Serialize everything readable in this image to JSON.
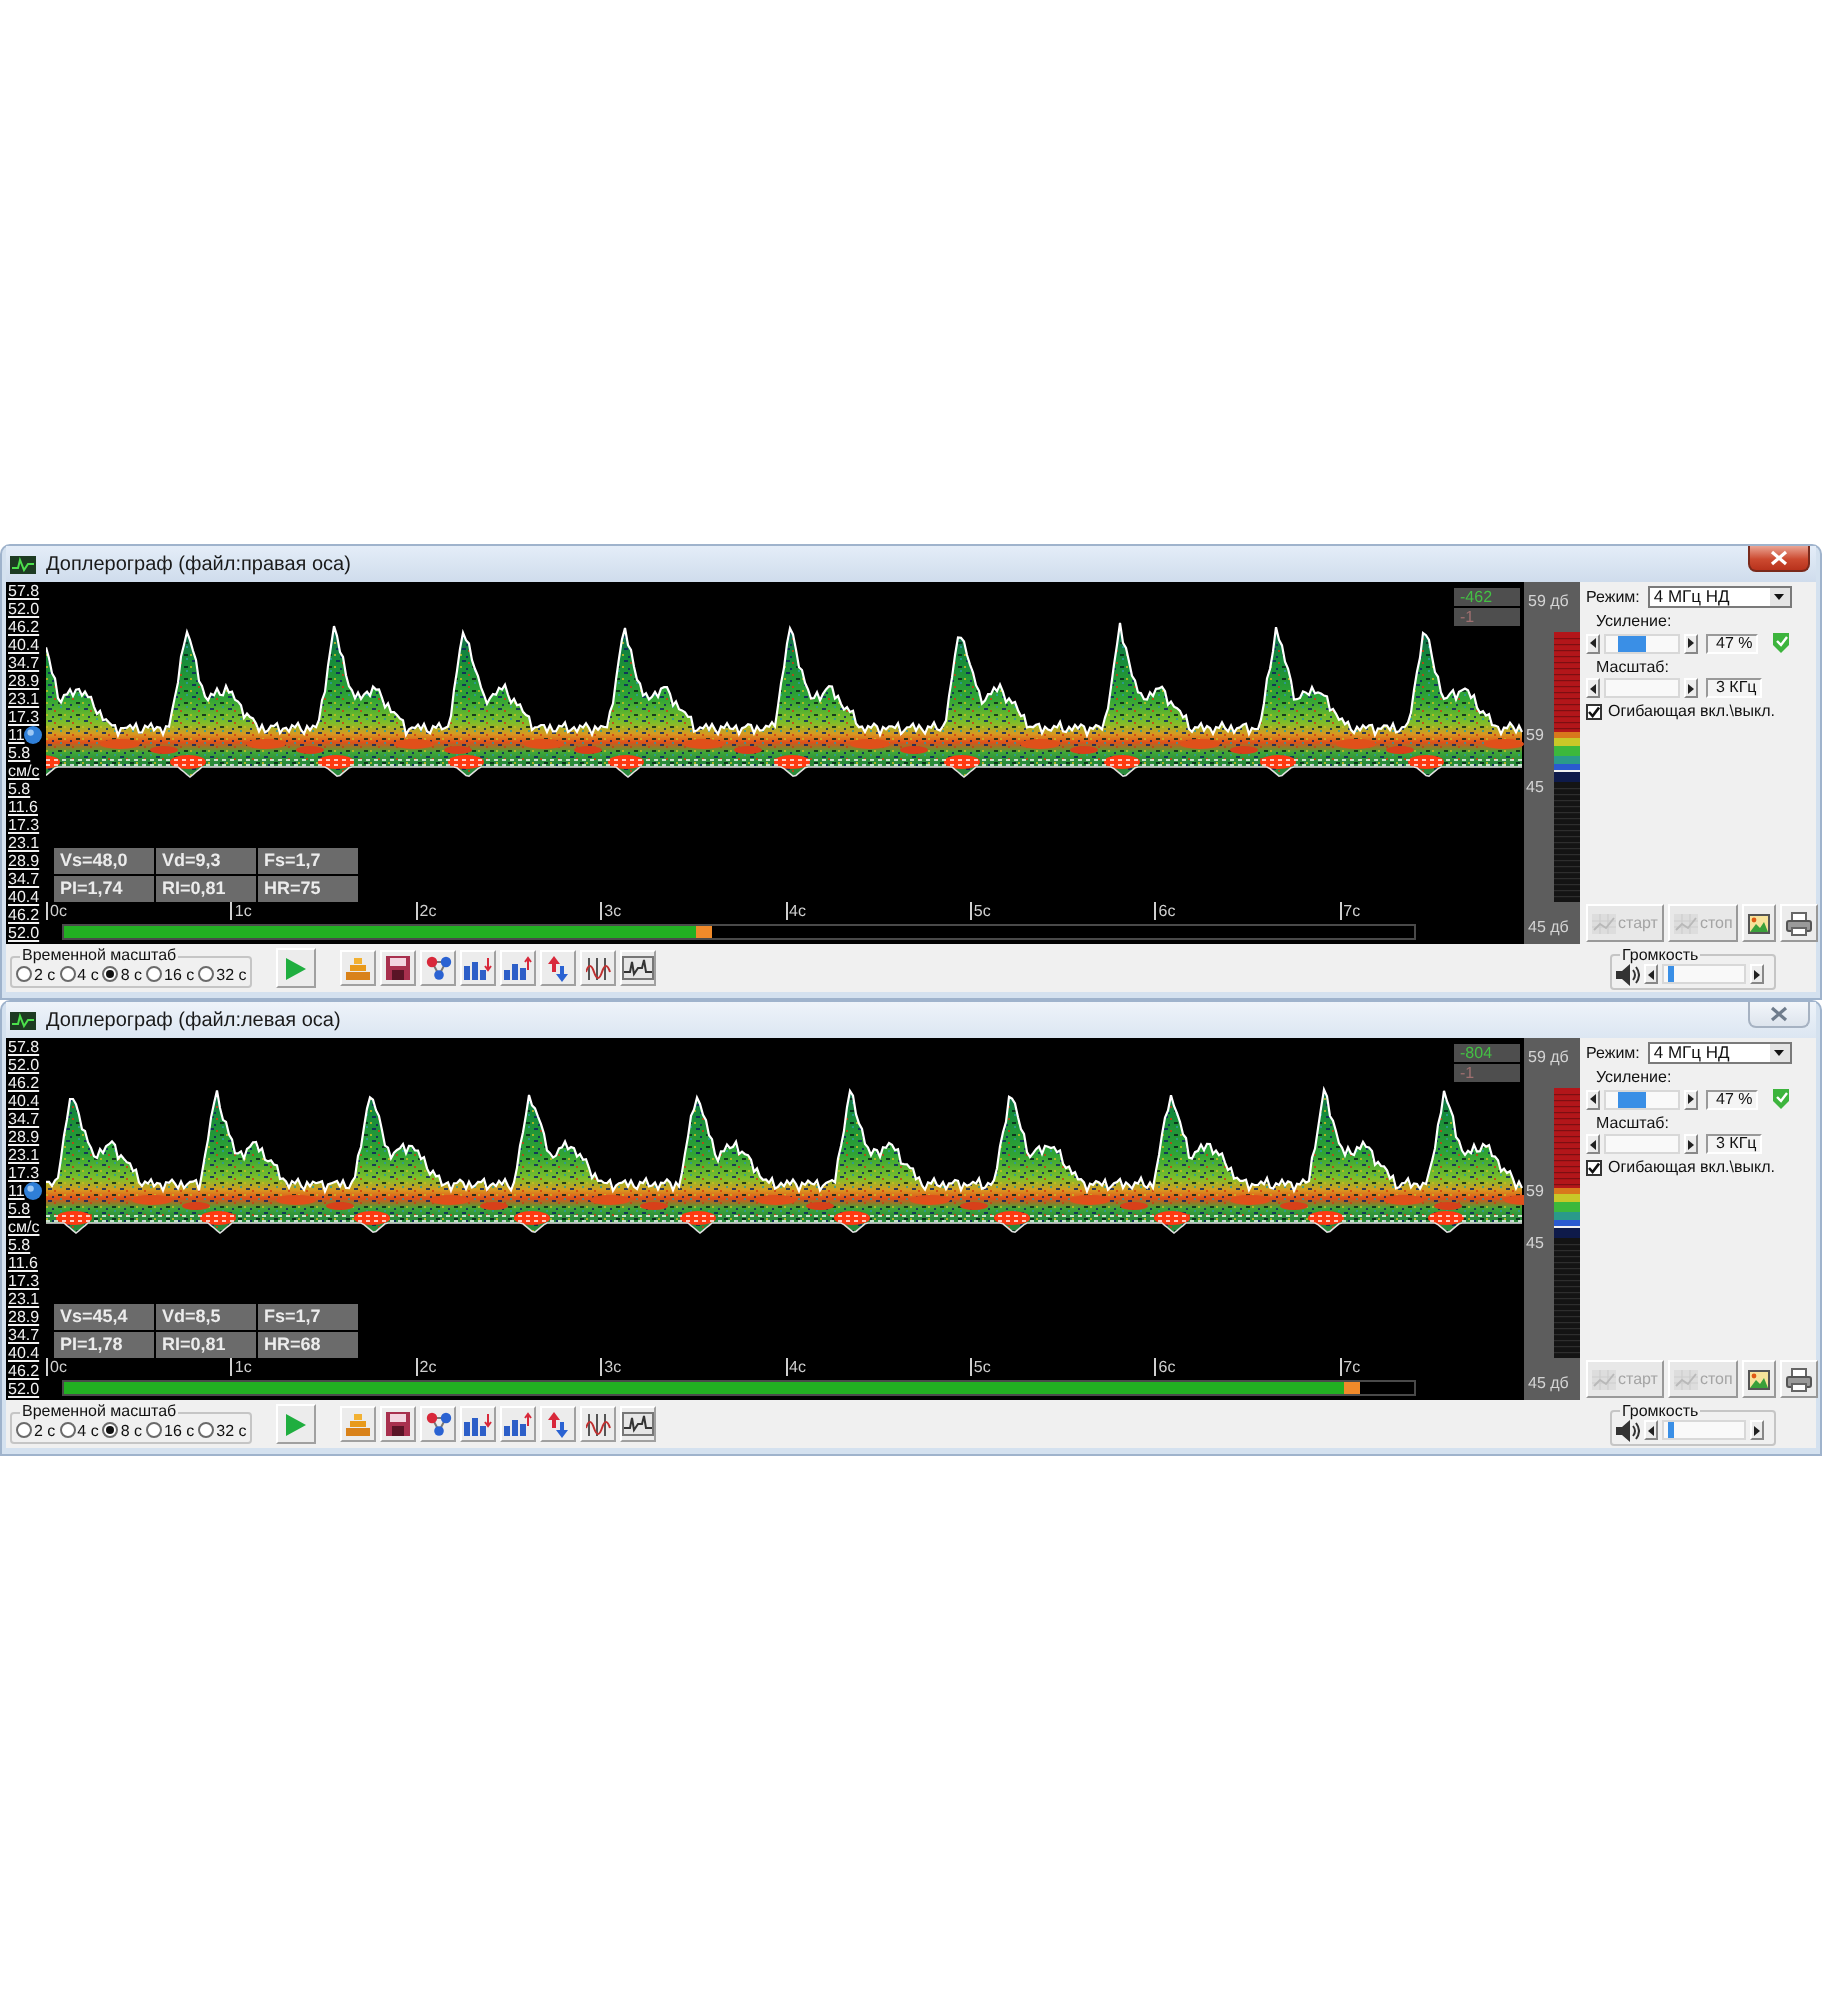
{
  "windows": [
    {
      "title": "Доплерограф (файл:правая оса)",
      "active": true,
      "velocity_axis": {
        "upper": [
          {
            "text": "57.8",
            "marker": false
          },
          {
            "text": "52.0",
            "marker": false
          },
          {
            "text": "46.2",
            "marker": false
          },
          {
            "text": "40.4",
            "marker": false
          },
          {
            "text": "34.7",
            "marker": false
          },
          {
            "text": "28.9",
            "marker": false
          },
          {
            "text": "23.1",
            "marker": false
          },
          {
            "text": "17.3",
            "marker": false
          },
          {
            "text": "11",
            "marker": true
          },
          {
            "text": "5.8",
            "marker": false
          }
        ],
        "unit": "см/с",
        "lower": [
          "5.8",
          "11.6",
          "17.3",
          "23.1",
          "28.9",
          "34.7",
          "40.4",
          "46.2",
          "52.0"
        ]
      },
      "counters": [
        "-462",
        "-1"
      ],
      "measurements": [
        "Vs=48,0",
        "Vd=9,3",
        "Fs=1,7",
        "PI=1,74",
        "RI=0,81",
        "HR=75"
      ],
      "time_ticks": [
        "0с",
        "1с",
        "2с",
        "3с",
        "4с",
        "5с",
        "6с",
        "7с"
      ],
      "playback": {
        "level": 0.48
      },
      "db_scale": {
        "top": "59 дб",
        "upper": "59",
        "lower": "45",
        "bottom": "45 дб"
      },
      "controls": {
        "mode_label": "Режим:",
        "mode": "4 МГц НД",
        "gain_label": "Усиление:",
        "gain": {
          "level": 0.25,
          "value": "47 %"
        },
        "scale_label": "Масштаб:",
        "scale": {
          "value": "3 КГц"
        },
        "envelope": {
          "label": "Огибающая вкл.\\выкл.",
          "checked": true
        }
      },
      "action_buttons": [
        {
          "kind": "start",
          "label": "старт",
          "disabled": true
        },
        {
          "kind": "stop",
          "label": "стоп",
          "disabled": true
        },
        {
          "kind": "snapshot",
          "disabled": false
        },
        {
          "kind": "print",
          "disabled": false
        }
      ],
      "time_scale": {
        "label": "Временной масштаб",
        "options": [
          {
            "label": "2 с",
            "selected": false
          },
          {
            "label": "4 с",
            "selected": false
          },
          {
            "label": "8 с",
            "selected": true
          },
          {
            "label": "16 с",
            "selected": false
          },
          {
            "label": "32 с",
            "selected": false
          }
        ]
      },
      "toolbar": [
        {
          "kind": "play"
        },
        {
          "kind": "stack"
        },
        {
          "kind": "save"
        },
        {
          "kind": "nodes"
        },
        {
          "kind": "chart_down"
        },
        {
          "kind": "chart_up"
        },
        {
          "kind": "swap"
        },
        {
          "kind": "filter"
        },
        {
          "kind": "strip"
        }
      ],
      "volume": {
        "label": "Громкость",
        "level": 0.05
      }
    },
    {
      "title": "Доплерограф (файл:левая оса)",
      "active": false,
      "velocity_axis": {
        "upper": [
          {
            "text": "57.8",
            "marker": false
          },
          {
            "text": "52.0",
            "marker": false
          },
          {
            "text": "46.2",
            "marker": false
          },
          {
            "text": "40.4",
            "marker": false
          },
          {
            "text": "34.7",
            "marker": false
          },
          {
            "text": "28.9",
            "marker": false
          },
          {
            "text": "23.1",
            "marker": false
          },
          {
            "text": "17.3",
            "marker": false
          },
          {
            "text": "11",
            "marker": true
          },
          {
            "text": "5.8",
            "marker": false
          }
        ],
        "unit": "см/с",
        "lower": [
          "5.8",
          "11.6",
          "17.3",
          "23.1",
          "28.9",
          "34.7",
          "40.4",
          "46.2",
          "52.0"
        ]
      },
      "counters": [
        "-804",
        "-1"
      ],
      "measurements": [
        "Vs=45,4",
        "Vd=8,5",
        "Fs=1,7",
        "PI=1,78",
        "RI=0,81",
        "HR=68"
      ],
      "time_ticks": [
        "0с",
        "1с",
        "2с",
        "3с",
        "4с",
        "5с",
        "6с",
        "7с"
      ],
      "playback": {
        "level": 0.96
      },
      "db_scale": {
        "top": "59 дб",
        "upper": "59",
        "lower": "45",
        "bottom": "45 дб"
      },
      "controls": {
        "mode_label": "Режим:",
        "mode": "4 МГц НД",
        "gain_label": "Усиление:",
        "gain": {
          "level": 0.25,
          "value": "47 %"
        },
        "scale_label": "Масштаб:",
        "scale": {
          "value": "3 КГц"
        },
        "envelope": {
          "label": "Огибающая вкл.\\выкл.",
          "checked": true
        }
      },
      "action_buttons": [
        {
          "kind": "start",
          "label": "старт",
          "disabled": true
        },
        {
          "kind": "stop",
          "label": "стоп",
          "disabled": true
        },
        {
          "kind": "snapshot",
          "disabled": false
        },
        {
          "kind": "print",
          "disabled": false
        }
      ],
      "time_scale": {
        "label": "Временной масштаб",
        "options": [
          {
            "label": "2 с",
            "selected": false
          },
          {
            "label": "4 с",
            "selected": false
          },
          {
            "label": "8 с",
            "selected": true
          },
          {
            "label": "16 с",
            "selected": false
          },
          {
            "label": "32 с",
            "selected": false
          }
        ]
      },
      "toolbar": [
        {
          "kind": "play"
        },
        {
          "kind": "stack"
        },
        {
          "kind": "save"
        },
        {
          "kind": "nodes"
        },
        {
          "kind": "chart_down"
        },
        {
          "kind": "chart_up"
        },
        {
          "kind": "swap"
        },
        {
          "kind": "filter"
        },
        {
          "kind": "strip"
        }
      ],
      "volume": {
        "label": "Громкость",
        "level": 0.05
      }
    }
  ]
}
